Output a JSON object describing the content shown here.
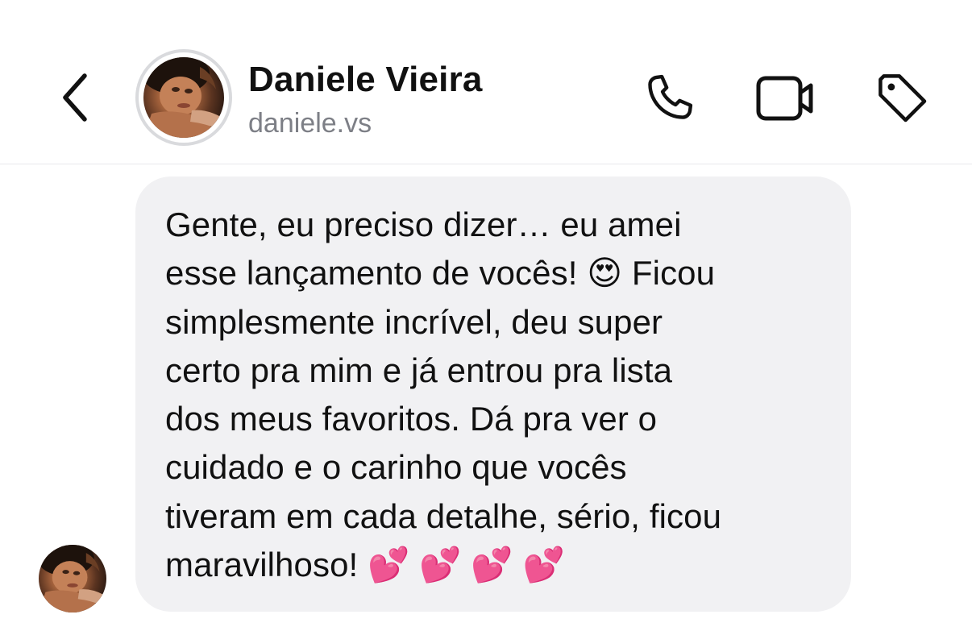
{
  "header": {
    "back_icon": "chevron-left-icon",
    "contact_name": "Daniele Vieira",
    "contact_handle": "daniele.vs",
    "avatar_icon": "profile-photo",
    "actions": [
      {
        "name": "call",
        "icon": "phone-icon"
      },
      {
        "name": "video",
        "icon": "video-camera-icon"
      },
      {
        "name": "tag",
        "icon": "tag-icon"
      }
    ]
  },
  "conversation": {
    "messages": [
      {
        "sender": "Daniele Vieira",
        "text": "Gente, eu preciso dizer… eu amei\nesse lançamento de vocês! 😍 Ficou\nsimplesmente incrível, deu super\ncerto pra mim e já entrou pra lista\ndos meus favoritos. Dá pra ver o\ncuidado e o carinho que vocês\ntiveram em cada detalhe, sério, ficou\nmaravilhoso! 💕 💕 💕 💕"
      }
    ]
  },
  "colors": {
    "bubble_background": "#f1f1f3",
    "text": "#111111",
    "secondary_text": "#7d7f86",
    "divider": "#e9e9ec",
    "avatar_ring": "#d9dadd"
  }
}
